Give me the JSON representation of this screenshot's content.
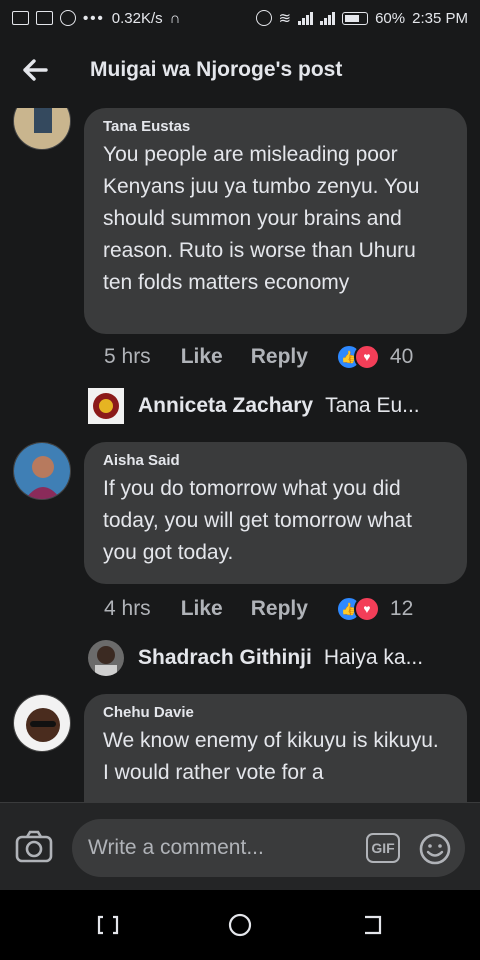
{
  "status_bar": {
    "speed": "0.32K/s",
    "battery": "60%",
    "time": "2:35 PM"
  },
  "header": {
    "title": "Muigai wa Njoroge's post"
  },
  "comments": [
    {
      "author": "Tana Eustas",
      "text": "You people are misleading poor Kenyans juu ya tumbo zenyu. You should summon your brains and reason. Ruto is worse than Uhuru ten folds matters economy",
      "time": "5 hrs",
      "like": "Like",
      "reply": "Reply",
      "reactions": "40",
      "reply_preview": {
        "name": "Anniceta Zachary",
        "snippet": "Tana Eu..."
      }
    },
    {
      "author": "Aisha Said",
      "text": "If you do tomorrow what you did today, you will get tomorrow what you got today.",
      "time": "4 hrs",
      "like": "Like",
      "reply": "Reply",
      "reactions": "12",
      "reply_preview": {
        "name": "Shadrach Githinji",
        "snippet": "Haiya ka..."
      }
    },
    {
      "author": "Chehu Davie",
      "text": "We know enemy of kikuyu is kikuyu. I would rather vote for a"
    }
  ],
  "composer": {
    "placeholder": "Write a comment...",
    "gif": "GIF"
  },
  "colors": {
    "background": "#18191a",
    "bubble": "#3a3b3c",
    "like_blue": "#2e89ff",
    "love_red": "#f33e58"
  }
}
